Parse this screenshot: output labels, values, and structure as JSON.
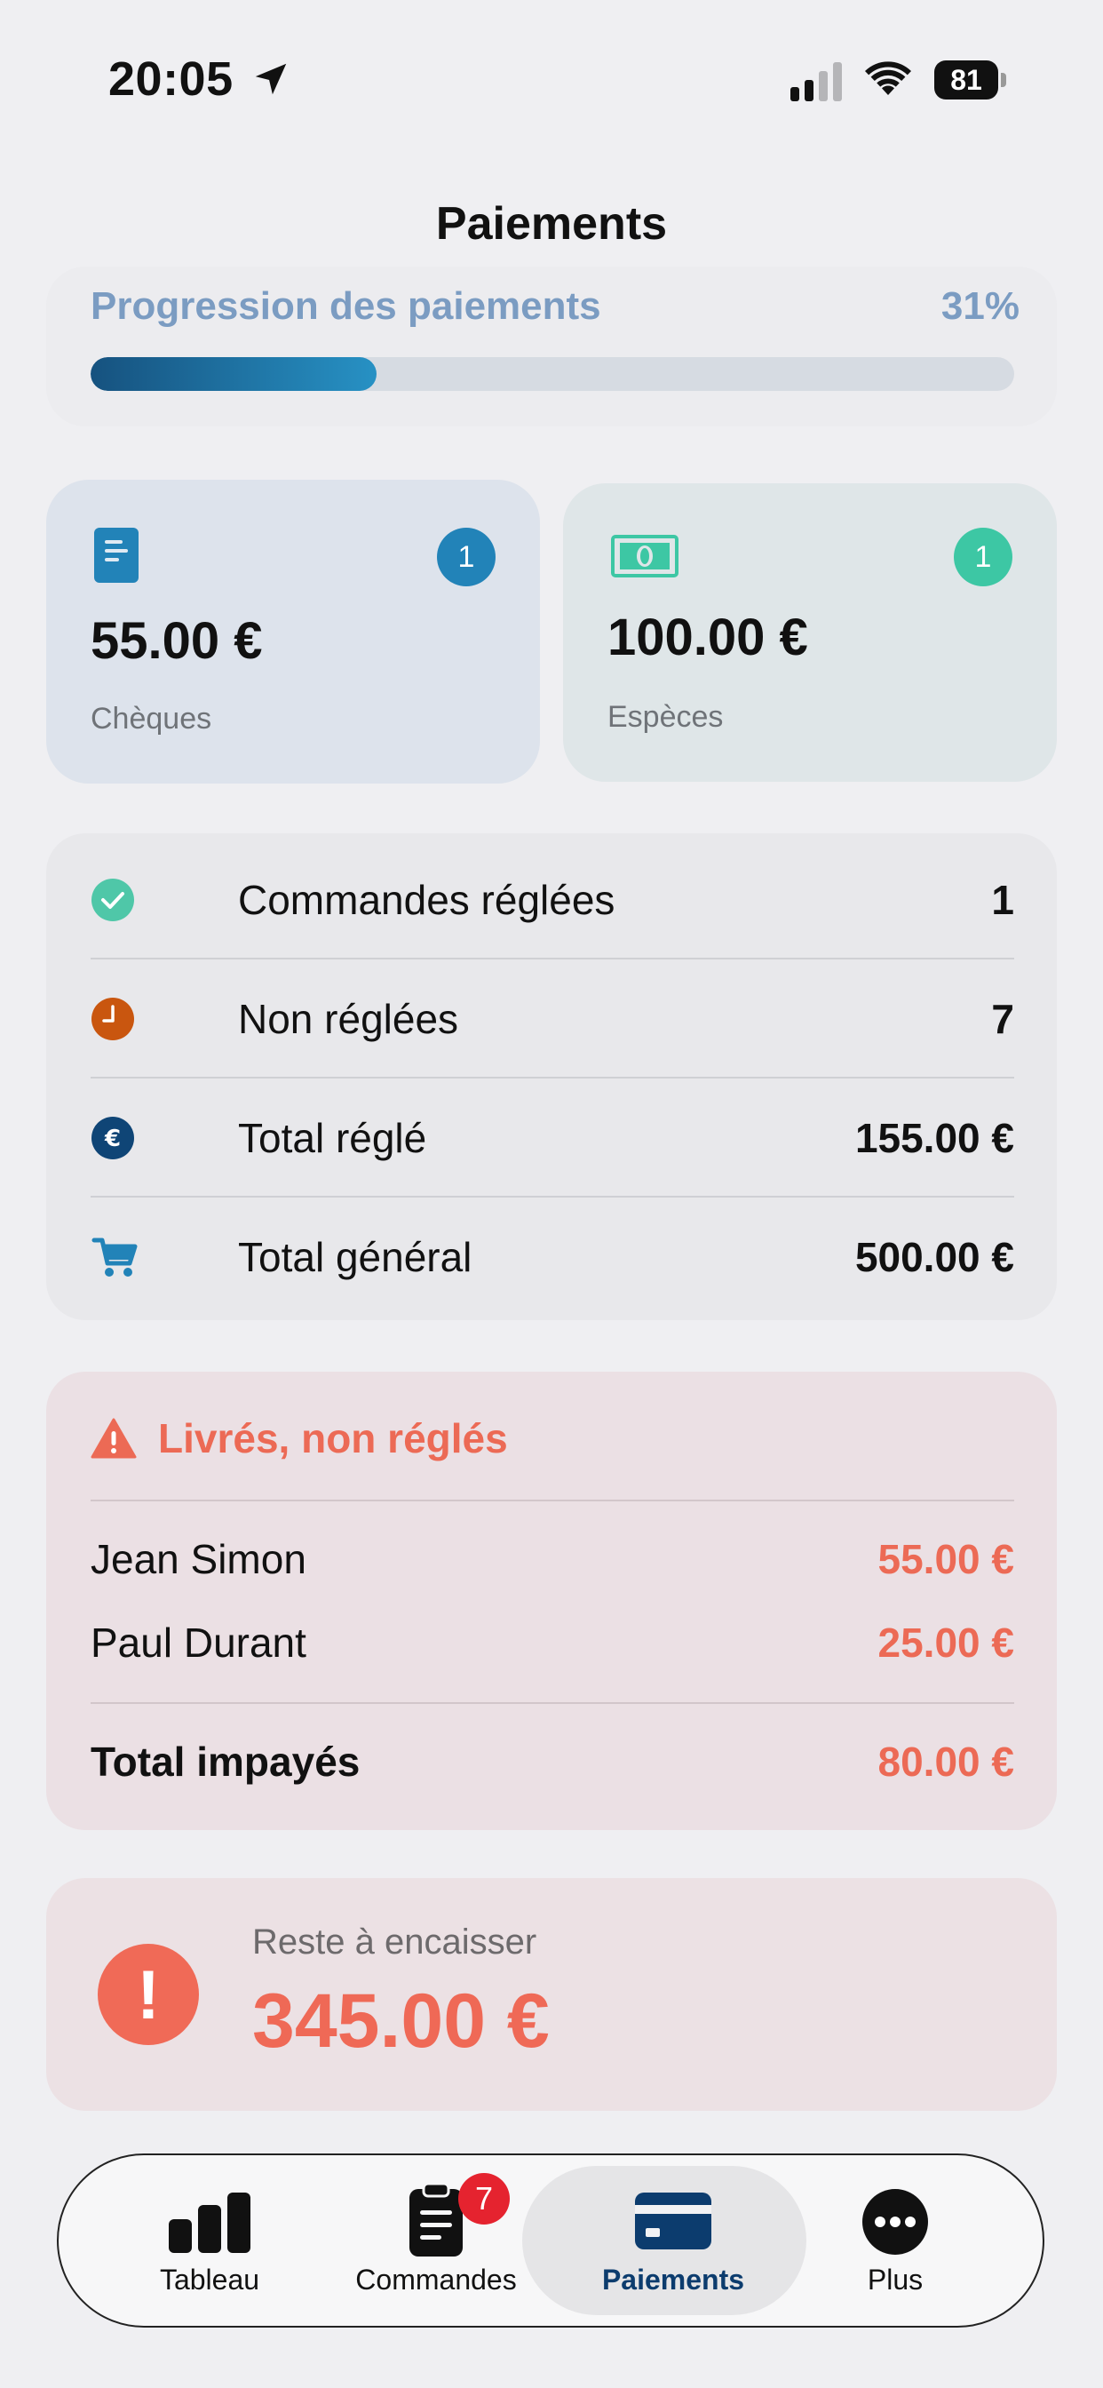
{
  "status_bar": {
    "time": "20:05",
    "battery": "81"
  },
  "page": {
    "title": "Paiements"
  },
  "progress": {
    "label": "Progression des paiements",
    "percent_label": "31%",
    "fraction": 0.31
  },
  "methods": [
    {
      "amount": "55.00 €",
      "label": "Chèques",
      "count": "1",
      "icon": "cheque-icon"
    },
    {
      "amount": "100.00 €",
      "label": "Espèces",
      "count": "1",
      "icon": "banknote-icon"
    }
  ],
  "summary": [
    {
      "label": "Commandes réglées",
      "value": "1",
      "icon": "check-circle-icon"
    },
    {
      "label": "Non réglées",
      "value": "7",
      "icon": "clock-icon"
    },
    {
      "label": "Total réglé",
      "value": "155.00 €",
      "icon": "euro-icon"
    },
    {
      "label": "Total général",
      "value": "500.00 €",
      "icon": "cart-icon"
    }
  ],
  "unpaid": {
    "title": "Livrés, non réglés",
    "rows": [
      {
        "name": "Jean Simon",
        "amount": "55.00 €"
      },
      {
        "name": "Paul Durant",
        "amount": "25.00 €"
      }
    ],
    "total_label": "Total impayés",
    "total_amount": "80.00 €"
  },
  "remaining": {
    "label": "Reste à encaisser",
    "amount": "345.00 €",
    "icon_glyph": "!"
  },
  "tabbar": {
    "tabs": [
      {
        "label": "Tableau",
        "icon": "bar-chart-icon"
      },
      {
        "label": "Commandes",
        "icon": "clipboard-icon",
        "badge": "7"
      },
      {
        "label": "Paiements",
        "icon": "credit-card-icon",
        "active": true
      },
      {
        "label": "Plus",
        "icon": "more-icon"
      }
    ]
  },
  "colors": {
    "accent": "#0c3c6e",
    "progress_blue": "#2283b8",
    "cash_green": "#3dc7a4",
    "warning_red": "#ec6a55",
    "clock_orange": "#c9560f"
  }
}
